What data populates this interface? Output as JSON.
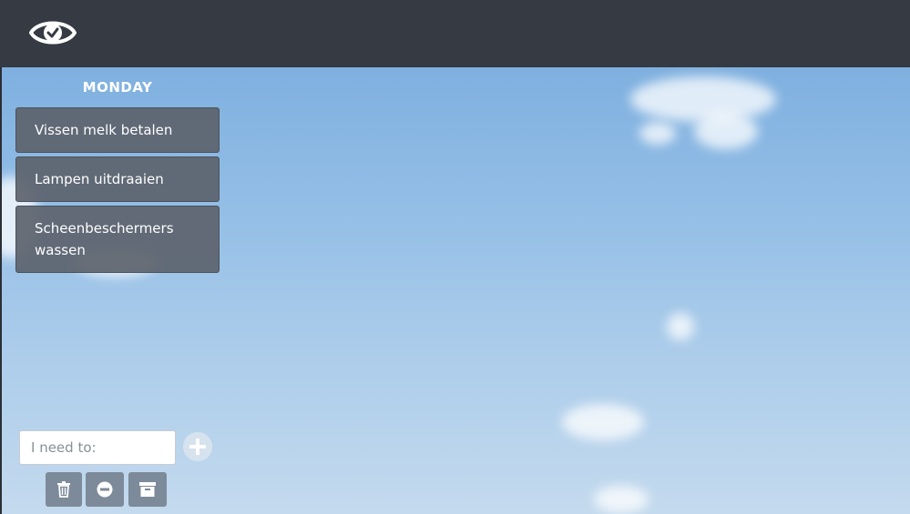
{
  "header": {
    "logo_icon": "eye-check-icon"
  },
  "board": {
    "day": "MONDAY",
    "tasks": [
      {
        "label": "Vissen melk betalen"
      },
      {
        "label": "Lampen uitdraaien"
      },
      {
        "label": "Scheenbeschermers wassen"
      }
    ]
  },
  "composer": {
    "placeholder": "I need to:",
    "value": "",
    "add_icon": "plus-circle-icon"
  },
  "actions": {
    "delete_icon": "trash-icon",
    "remove_icon": "minus-circle-icon",
    "archive_icon": "archive-box-icon"
  },
  "colors": {
    "topbar": "#353a43",
    "task_bg": "#5c636c",
    "action_bg": "#7d8a99"
  }
}
